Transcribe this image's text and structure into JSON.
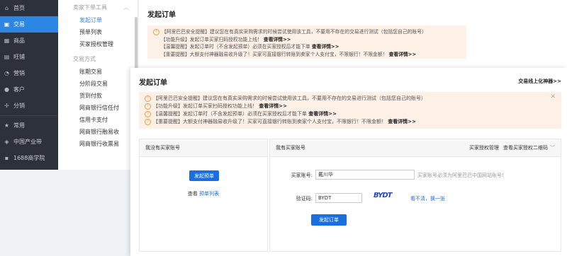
{
  "sidebar": {
    "items": [
      {
        "label": "首页",
        "icon": "home-icon",
        "glyph": "⌂",
        "active": false
      },
      {
        "label": "交易",
        "icon": "clipboard-icon",
        "glyph": "▣",
        "active": true
      },
      {
        "label": "商品",
        "icon": "grid-icon",
        "glyph": "▦",
        "active": false
      },
      {
        "label": "旺铺",
        "icon": "shop-icon",
        "glyph": "▤",
        "active": false
      },
      {
        "label": "营销",
        "icon": "marketing-icon",
        "glyph": "◔",
        "active": false
      },
      {
        "label": "客户",
        "icon": "customer-icon",
        "glyph": "●",
        "active": false
      },
      {
        "label": "分销",
        "icon": "distribution-icon",
        "glyph": "✢",
        "active": false
      },
      {
        "label": "常用",
        "icon": "star-icon",
        "glyph": "★",
        "active": false
      },
      {
        "label": "中国产业带",
        "icon": "shield-icon",
        "glyph": "◈",
        "active": false
      },
      {
        "label": "1688商学院",
        "icon": "academy-icon",
        "glyph": "▪",
        "active": false
      }
    ]
  },
  "submenu": {
    "group1_title": "卖家下单工具",
    "group1_items": [
      "发起订单",
      "预单列表",
      "买家授权管理"
    ],
    "group2_title": "交易方式",
    "group2_items": [
      "账期交易",
      "分阶段交易",
      "货到付款",
      "网商银行信任付",
      "信用卡支付",
      "网商银行融易收",
      "网商银行收票易"
    ]
  },
  "background_page": {
    "title": "发起订单",
    "notice_lines": [
      {
        "text": "【阿里巴巴安全提醒】建议您在有真实采购需求的时候尝试使用该工具，不要用不存在的交易进行测试（包括您自己的账号）",
        "link": ""
      },
      {
        "text": "【功能升级】发起订单买家扫码授权功能上线！",
        "link": "查看详情>>"
      },
      {
        "text": "【温馨提醒】发起订单时（不含发起预单）必须在买家授权后才能下单",
        "link": "查看详情>>"
      },
      {
        "text": "【重要提醒】大额支付神器融易收升级了！买家可直接银行转账到卖家个人支付宝，不限银行！不限金额！",
        "link": "查看详情>>"
      }
    ]
  },
  "modal": {
    "title": "发起订单",
    "tool_link": "交易线上化神器>>",
    "close_glyph": "✕",
    "notice_lines": [
      {
        "text": "【阿里巴巴安全提醒】建议您在有真实采购需求的时候尝试使用该工具，不要用不存在的交易进行测试（包括您自己的账号）",
        "link": ""
      },
      {
        "text": "【功能升级】发起订单买家扫码授权功能上线！",
        "link": "查看详情>>"
      },
      {
        "text": "【温馨提醒】发起订单时（不含发起预单）必须在买家授权后才能下单",
        "link": "查看详情>>"
      },
      {
        "text": "【重要提醒】大额支付神器融易收升级了！买家可直接银行转账到卖家个人支付宝，不限银行！不限金额！",
        "link": "查看详情>>"
      }
    ],
    "left_panel": {
      "header": "我没有买家账号",
      "button": "发起预单",
      "view_prefix": "查看",
      "view_link": "预单列表"
    },
    "right_panel": {
      "header": "我有买家账号",
      "auth_manage": "买家授权管理",
      "auth_qr": "查看买家授权二维码",
      "account_label": "买家账号:",
      "account_value": "戴川华",
      "account_hint": "买家账号必须为阿里巴巴中国网站账号!",
      "code_label": "验证码:",
      "code_value": "BYDT",
      "captcha_text": "BYDT",
      "refresh": "看不清，换一张",
      "submit": "发起订单"
    }
  },
  "colors": {
    "sidebar_bg": "#2d313c",
    "accent_blue": "#2b86e4",
    "button_blue": "#1a6fe0",
    "notice_bg": "#fdf0e6",
    "warning_orange": "#f29b38"
  }
}
